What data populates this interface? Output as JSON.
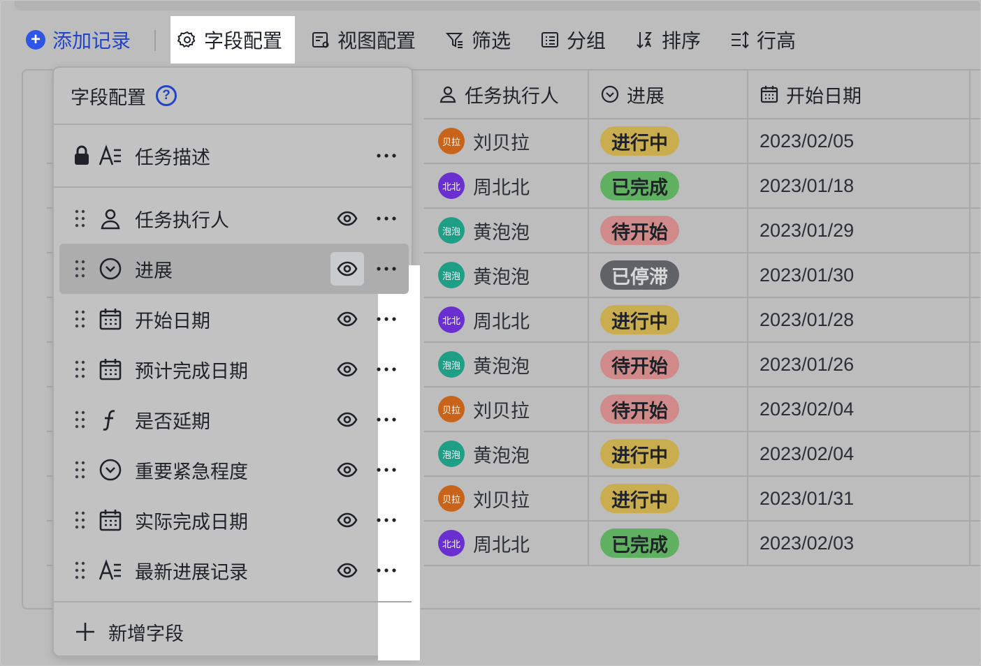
{
  "toolbar": {
    "add_record": "添加记录",
    "field_config": "字段配置",
    "view_config": "视图配置",
    "filter": "筛选",
    "group": "分组",
    "sort": "排序",
    "row_height": "行高"
  },
  "table": {
    "headers": {
      "assignee": "任务执行人",
      "progress": "进展",
      "start_date": "开始日期"
    },
    "rows": [
      {
        "avatar": "贝拉",
        "assignee": "刘贝拉",
        "progress": "进行中",
        "date": "2023/02/05"
      },
      {
        "avatar": "北北",
        "assignee": "周北北",
        "progress": "已完成",
        "date": "2023/01/18"
      },
      {
        "avatar": "泡泡",
        "assignee": "黄泡泡",
        "progress": "待开始",
        "date": "2023/01/29"
      },
      {
        "avatar": "泡泡",
        "assignee": "黄泡泡",
        "progress": "已停滞",
        "date": "2023/01/30"
      },
      {
        "avatar": "北北",
        "assignee": "周北北",
        "progress": "进行中",
        "date": "2023/01/28"
      },
      {
        "avatar": "泡泡",
        "assignee": "黄泡泡",
        "progress": "待开始",
        "date": "2023/01/26"
      },
      {
        "avatar": "贝拉",
        "assignee": "刘贝拉",
        "progress": "待开始",
        "date": "2023/02/04"
      },
      {
        "avatar": "泡泡",
        "assignee": "黄泡泡",
        "progress": "进行中",
        "date": "2023/02/04"
      },
      {
        "avatar": "贝拉",
        "assignee": "刘贝拉",
        "progress": "进行中",
        "date": "2023/01/31"
      },
      {
        "avatar": "北北",
        "assignee": "周北北",
        "progress": "已完成",
        "date": "2023/02/03"
      }
    ]
  },
  "avatar_colors": {
    "贝拉": "#c9631a",
    "北北": "#6a2fd1",
    "泡泡": "#1f9e86"
  },
  "status_colors": {
    "进行中": {
      "bg": "#c9ad4f",
      "fg": "#1f2329"
    },
    "已完成": {
      "bg": "#5fb060",
      "fg": "#1f2329"
    },
    "待开始": {
      "bg": "#d08a8a",
      "fg": "#1f2329"
    },
    "已停滞": {
      "bg": "#5f6368",
      "fg": "#d9d9d9"
    }
  },
  "panel": {
    "title": "字段配置",
    "primary_field": "任务描述",
    "fields": [
      {
        "label": "任务执行人",
        "icon": "person-icon"
      },
      {
        "label": "进展",
        "icon": "single-select-icon"
      },
      {
        "label": "开始日期",
        "icon": "calendar-icon"
      },
      {
        "label": "预计完成日期",
        "icon": "calendar-icon"
      },
      {
        "label": "是否延期",
        "icon": "formula-icon"
      },
      {
        "label": "重要紧急程度",
        "icon": "single-select-icon"
      },
      {
        "label": "实际完成日期",
        "icon": "calendar-icon"
      },
      {
        "label": "最新进展记录",
        "icon": "text-icon"
      }
    ],
    "add_field": "新增字段"
  }
}
